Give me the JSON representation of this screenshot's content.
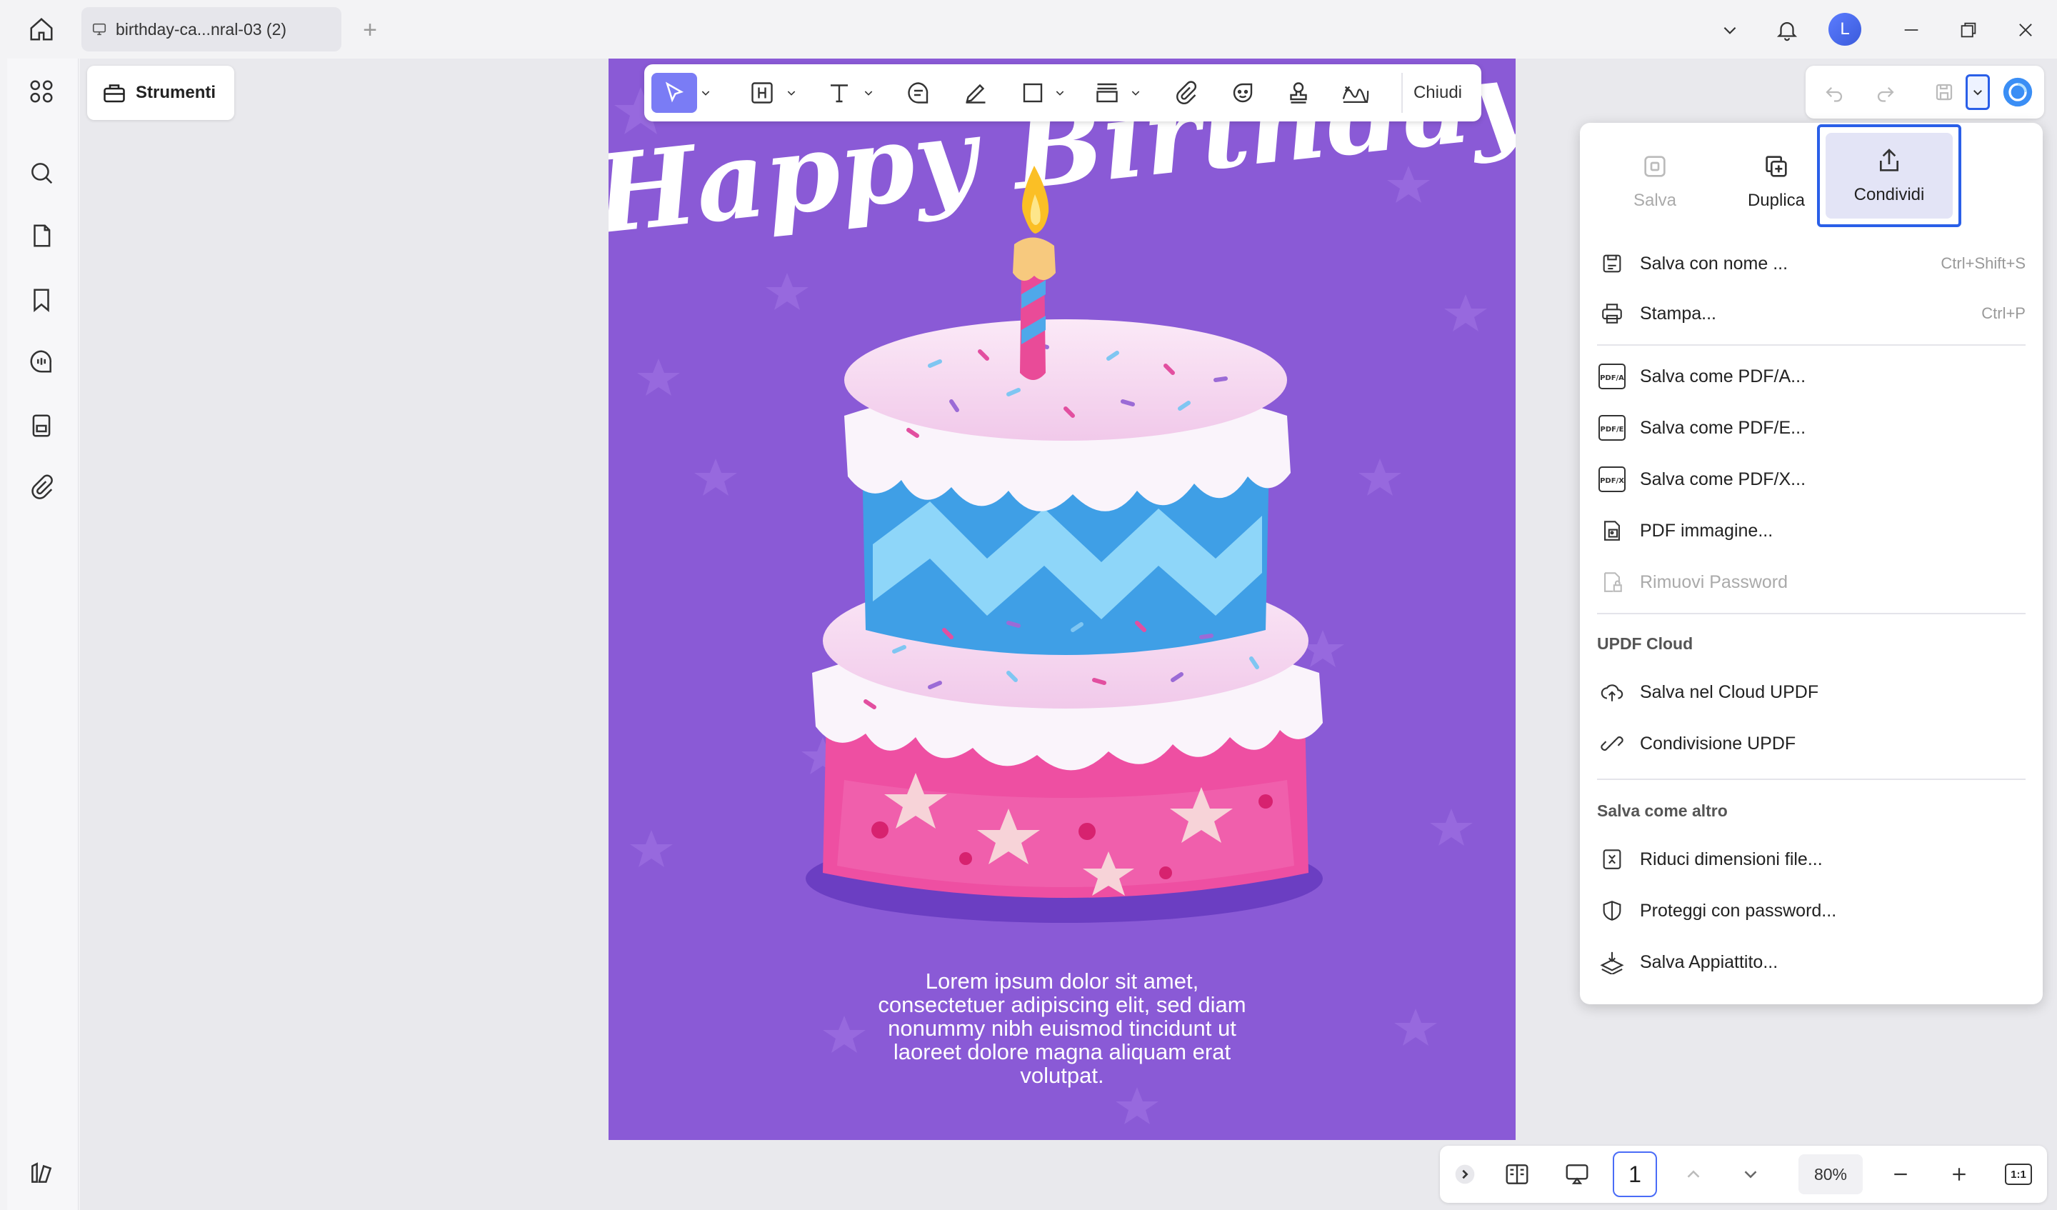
{
  "window": {
    "tab_title": "birthday-ca...nral-03 (2)",
    "avatar_letter": "L"
  },
  "tools_button": {
    "label": "Strumenti"
  },
  "annotation_toolbar": {
    "close_label": "Chiudi",
    "tools": [
      "select",
      "highlight",
      "text",
      "comment",
      "pencil",
      "shape",
      "text-box",
      "attachment",
      "sticker",
      "stamp",
      "signature"
    ]
  },
  "document": {
    "headline": "Happy Birthday",
    "body_lines": [
      "Lorem ipsum dolor sit amet,",
      "consectetuer adipiscing elit, sed diam",
      "nonummy nibh euismod tincidunt ut",
      "laoreet dolore magna aliquam erat",
      "volutpat."
    ],
    "background_color": "#8a5ad6"
  },
  "save_menu": {
    "top_actions": [
      {
        "label": "Salva",
        "state": "disabled"
      },
      {
        "label": "Duplica",
        "state": "normal"
      },
      {
        "label": "Condividi",
        "state": "selected"
      }
    ],
    "items_1": [
      {
        "label": "Salva con nome ...",
        "shortcut": "Ctrl+Shift+S",
        "icon": "save-as-icon"
      },
      {
        "label": "Stampa...",
        "shortcut": "Ctrl+P",
        "icon": "print-icon"
      }
    ],
    "items_2": [
      {
        "label": "Salva come PDF/A...",
        "icon": "pdfa-icon",
        "icon_text": "PDF/A"
      },
      {
        "label": "Salva come PDF/E...",
        "icon": "pdfe-icon",
        "icon_text": "PDF/E"
      },
      {
        "label": "Salva come PDF/X...",
        "icon": "pdfx-icon",
        "icon_text": "PDF/X"
      },
      {
        "label": "PDF immagine...",
        "icon": "image-pdf-icon"
      },
      {
        "label": "Rimuovi Password",
        "icon": "remove-password-icon",
        "disabled": true
      }
    ],
    "cloud_heading": "UPDF Cloud",
    "cloud_items": [
      {
        "label": "Salva nel Cloud UPDF",
        "icon": "cloud-upload-icon"
      },
      {
        "label": "Condivisione UPDF",
        "icon": "link-icon"
      }
    ],
    "other_heading": "Salva come altro",
    "other_items": [
      {
        "label": "Riduci dimensioni file...",
        "icon": "compress-icon"
      },
      {
        "label": "Proteggi con password...",
        "icon": "shield-icon"
      },
      {
        "label": "Salva Appiattito...",
        "icon": "flatten-icon"
      }
    ]
  },
  "bottom_bar": {
    "page_number": "1",
    "zoom": "80%",
    "fit_label": "1:1"
  },
  "colors": {
    "accent": "#4a6cf7",
    "page_purple": "#8a5ad6",
    "selection_purple": "#7a7cf5"
  }
}
